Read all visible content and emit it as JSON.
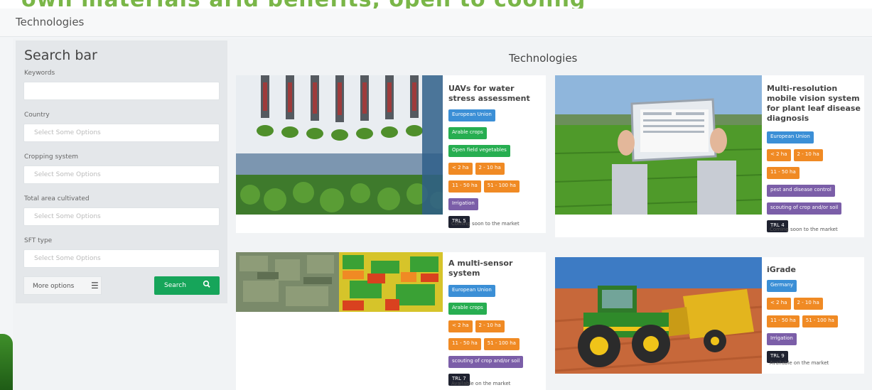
{
  "banner": {
    "text": "own materials arid benefits, open to cooling"
  },
  "window": {
    "title": "Technologies"
  },
  "sidebar": {
    "title": "Search bar",
    "fields": [
      {
        "label": "Keywords",
        "value": ""
      },
      {
        "label": "Country",
        "placeholder": "Select Some Options"
      },
      {
        "label": "Cropping system",
        "placeholder": "Select Some Options"
      },
      {
        "label": "Total area cultivated",
        "placeholder": "Select Some Options"
      },
      {
        "label": "SFT type",
        "placeholder": "Select Some Options"
      }
    ],
    "more_options_label": "More options",
    "more_options_icon": "menu-icon",
    "search_label": "Search",
    "search_icon": "search-icon"
  },
  "main": {
    "title": "Technologies",
    "cards": [
      {
        "title": "UAVs for water stress assessment",
        "image": "hydroponic-seedlings-photo",
        "tags": [
          "European Union",
          "Arable crops",
          "Open field vegetables",
          "< 2 ha",
          "2 - 10 ha",
          "11 - 50 ha",
          "51 - 100 ha",
          "Irrigation"
        ],
        "trl": "TRL 5",
        "status": "Coming soon to the market"
      },
      {
        "title": "Multi-resolution mobile vision system for plant leaf disease diagnosis",
        "image": "tablet-in-field-photo",
        "tags": [
          "European Union",
          "< 2 ha",
          "2 - 10 ha",
          "11 - 50 ha",
          "pest and disease control",
          "scouting of crop and/or soil"
        ],
        "trl": "TRL 4",
        "status": "Coming soon to the market"
      },
      {
        "title": "A multi-sensor system",
        "image": "aerial-ndvi-map-photo",
        "tags": [
          "European Union",
          "Arable crops",
          "< 2 ha",
          "2 - 10 ha",
          "11 - 50 ha",
          "51 - 100 ha",
          "scouting of crop and/or soil"
        ],
        "trl": "TRL 7",
        "status": "Available on the market"
      },
      {
        "title": "iGrade",
        "image": "tractor-grader-photo",
        "tags": [
          "Germany",
          "< 2 ha",
          "2 - 10 ha",
          "11 - 50 ha",
          "51 - 100 ha",
          "Irrigation"
        ],
        "trl": "TRL 9",
        "status": "Available on the market"
      }
    ]
  },
  "colors": {
    "search_button": "#16a55a",
    "badge_country": "#3b8fd6",
    "badge_crop": "#27ae51",
    "badge_area": "#f08a24",
    "badge_type": "#7b5ea8",
    "badge_trl": "#1f2230"
  }
}
